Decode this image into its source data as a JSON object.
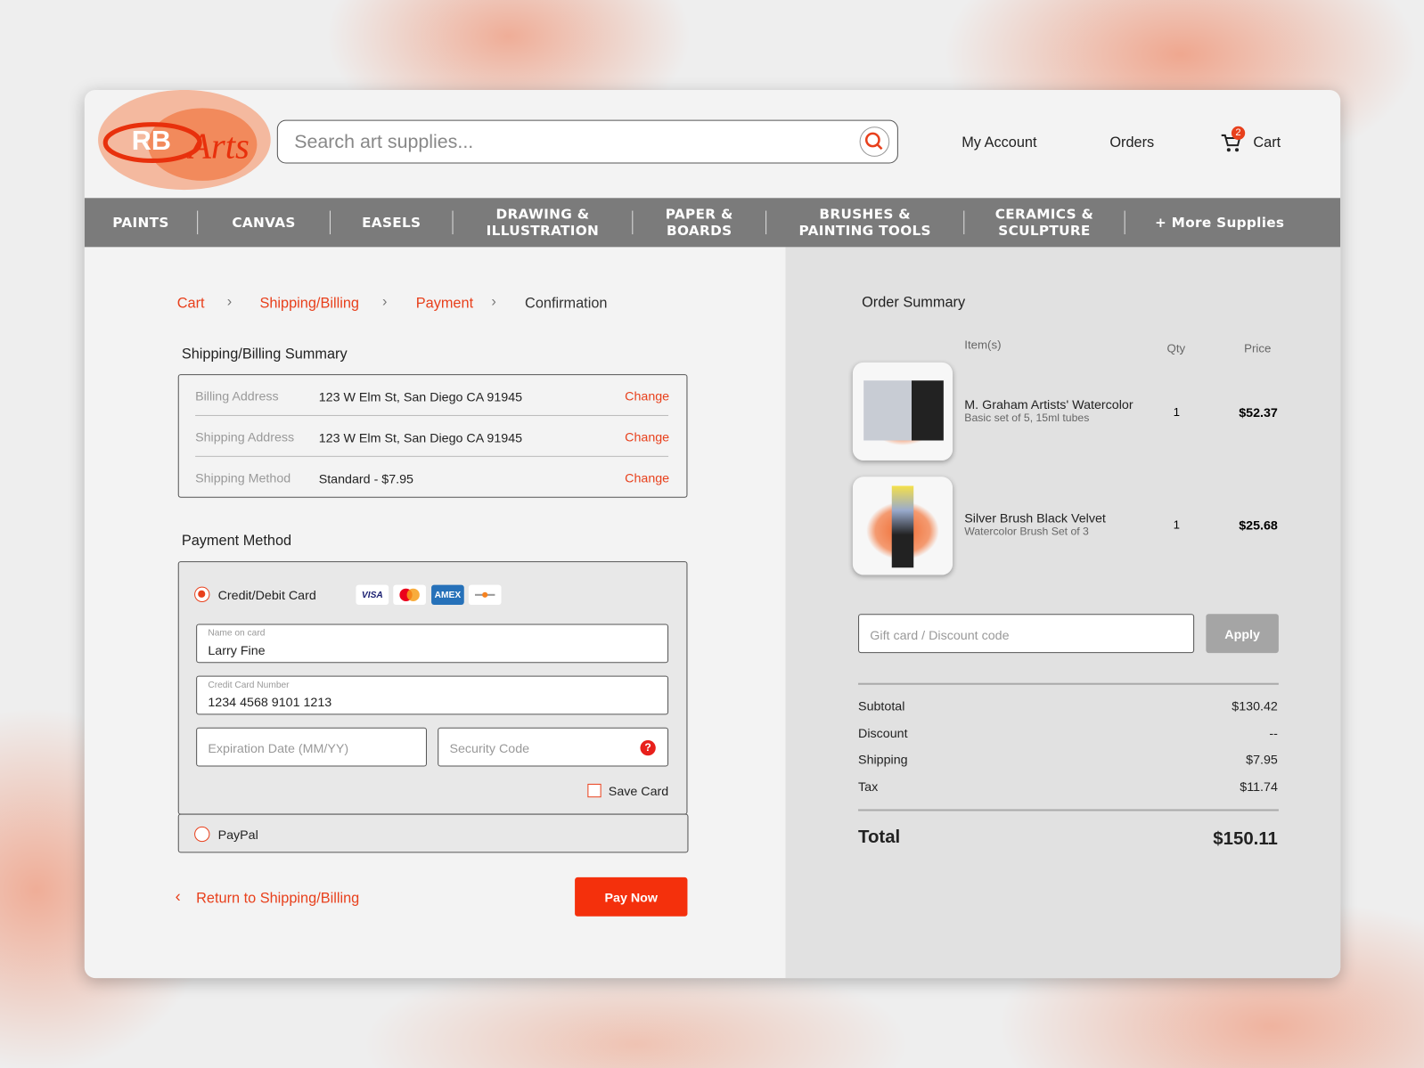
{
  "header": {
    "logo_text": "RBArts",
    "search_placeholder": "Search art supplies...",
    "my_account": "My Account",
    "orders": "Orders",
    "cart": "Cart",
    "cart_count": "2"
  },
  "nav": [
    "PAINTS",
    "CANVAS",
    "EASELS",
    "DRAWING & ILLUSTRATION",
    "PAPER & BOARDS",
    "BRUSHES & PAINTING TOOLS",
    "CERAMICS & SCULPTURE",
    "+ More Supplies"
  ],
  "breadcrumb": [
    "Cart",
    "Shipping/Billing",
    "Payment",
    "Confirmation"
  ],
  "shipping_summary": {
    "title": "Shipping/Billing Summary",
    "rows": [
      {
        "label": "Billing Address",
        "value": "123 W Elm St, San Diego CA 91945",
        "action": "Change"
      },
      {
        "label": "Shipping Address",
        "value": "123 W Elm St, San Diego CA 91945",
        "action": "Change"
      },
      {
        "label": "Shipping Method",
        "value": "Standard - $7.95",
        "action": "Change"
      }
    ]
  },
  "payment": {
    "title": "Payment Method",
    "card_option": "Credit/Debit Card",
    "cards": [
      "VISA",
      "MC",
      "AMEX",
      "DISC"
    ],
    "name_label": "Name on card",
    "name_value": "Larry Fine",
    "number_label": "Credit Card Number",
    "number_value": "1234 4568 9101 1213",
    "exp_placeholder": "Expiration Date (MM/YY)",
    "cvc_placeholder": "Security Code",
    "help": "?",
    "save_card": "Save Card",
    "paypal": "PayPal"
  },
  "footer": {
    "back": "Return to Shipping/Billing",
    "pay": "Pay Now"
  },
  "order": {
    "title": "Order Summary",
    "col_items": "Item(s)",
    "col_qty": "Qty",
    "col_price": "Price",
    "items": [
      {
        "name": "M. Graham Artists' Watercolor",
        "sub": "Basic set of 5, 15ml tubes",
        "qty": "1",
        "price": "$52.37"
      },
      {
        "name": "Silver Brush Black Velvet",
        "sub": "Watercolor Brush Set of 3",
        "qty": "1",
        "price": "$25.68"
      }
    ],
    "discount_placeholder": "Gift card / Discount code",
    "apply": "Apply",
    "subtotal_label": "Subtotal",
    "subtotal": "$130.42",
    "discount_label": "Discount",
    "discount": "--",
    "shipping_label": "Shipping",
    "shipping": "$7.95",
    "tax_label": "Tax",
    "tax": "$11.74",
    "total_label": "Total",
    "total": "$150.11"
  },
  "colors": {
    "accent": "#e8401c",
    "nav": "#7b7b7b"
  }
}
